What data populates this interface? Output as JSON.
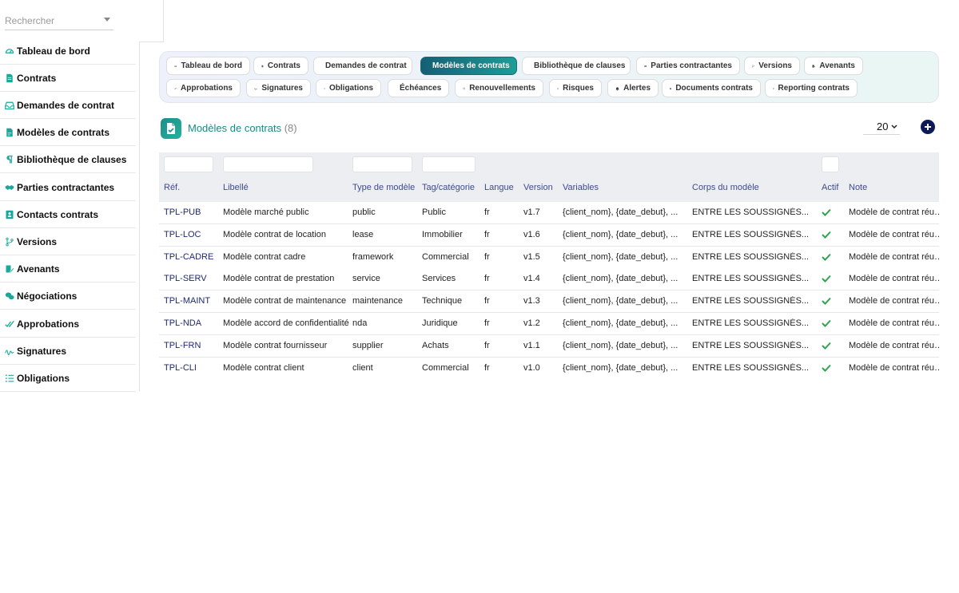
{
  "search": {
    "placeholder": "Rechercher"
  },
  "sidebar": {
    "items": [
      {
        "label": "Tableau de bord",
        "icon": "dashboard-icon"
      },
      {
        "label": "Contrats",
        "icon": "document-icon"
      },
      {
        "label": "Demandes de contrat",
        "icon": "inbox-icon"
      },
      {
        "label": "Modèles de contrats",
        "icon": "file-template-icon"
      },
      {
        "label": "Bibliothèque de clauses",
        "icon": "paragraph-icon"
      },
      {
        "label": "Parties contractantes",
        "icon": "handshake-icon"
      },
      {
        "label": "Contacts contrats",
        "icon": "contact-card-icon"
      },
      {
        "label": "Versions",
        "icon": "branch-icon"
      },
      {
        "label": "Avenants",
        "icon": "edit-document-icon"
      },
      {
        "label": "Négociations",
        "icon": "chat-icon"
      },
      {
        "label": "Approbations",
        "icon": "double-check-icon"
      },
      {
        "label": "Signatures",
        "icon": "signature-icon"
      },
      {
        "label": "Obligations",
        "icon": "list-icon"
      }
    ]
  },
  "tabs": {
    "row1": [
      {
        "label": "Tableau de bord",
        "icon": "dashboard-icon"
      },
      {
        "label": "Contrats",
        "icon": "document-icon"
      },
      {
        "label": "Demandes de contrat",
        "icon": "inbox-icon"
      },
      {
        "label": "Modèles de contrats",
        "icon": "file-template-icon",
        "active": true
      },
      {
        "label": "Bibliothèque de clauses",
        "icon": "paragraph-icon"
      },
      {
        "label": "Parties contractantes",
        "icon": "handshake-icon"
      },
      {
        "label": "Versions",
        "icon": "branch-icon"
      },
      {
        "label": "Avenants",
        "icon": "edit-document-icon"
      }
    ],
    "row2": [
      {
        "label": "Approbations",
        "icon": "double-check-icon"
      },
      {
        "label": "Signatures",
        "icon": "signature-icon"
      },
      {
        "label": "Obligations",
        "icon": "list-icon"
      },
      {
        "label": "Échéances",
        "icon": "calendar-icon"
      },
      {
        "label": "Renouvellements",
        "icon": "refresh-icon"
      },
      {
        "label": "Risques",
        "icon": "warning-icon"
      },
      {
        "label": "Alertes",
        "icon": "bell-icon"
      },
      {
        "label": "Documents contrats",
        "icon": "folder-icon"
      },
      {
        "label": "Reporting contrats",
        "icon": "pie-chart-icon"
      }
    ]
  },
  "header": {
    "title": "Modèles de contrats",
    "count": "(8)",
    "page_size": "20"
  },
  "table": {
    "columns": [
      "Réf.",
      "Libellé",
      "Type de modèle",
      "Tag/catégorie",
      "Langue",
      "Version",
      "Variables",
      "Corps du modèle",
      "Actif",
      "Note"
    ],
    "rows": [
      {
        "ref": "TPL-PUB",
        "libelle": "Modèle marché public",
        "type": "public",
        "tag": "Public",
        "langue": "fr",
        "version": "v1.7",
        "variables": "{client_nom}, {date_debut}, ...",
        "corps": "ENTRE LES SOUSSIGNÉS...",
        "actif": true,
        "note": "Modèle de contrat réutilisable"
      },
      {
        "ref": "TPL-LOC",
        "libelle": "Modèle contrat de location",
        "type": "lease",
        "tag": "Immobilier",
        "langue": "fr",
        "version": "v1.6",
        "variables": "{client_nom}, {date_debut}, ...",
        "corps": "ENTRE LES SOUSSIGNÉS...",
        "actif": true,
        "note": "Modèle de contrat réutilisable"
      },
      {
        "ref": "TPL-CADRE",
        "libelle": "Modèle contrat cadre",
        "type": "framework",
        "tag": "Commercial",
        "langue": "fr",
        "version": "v1.5",
        "variables": "{client_nom}, {date_debut}, ...",
        "corps": "ENTRE LES SOUSSIGNÉS...",
        "actif": true,
        "note": "Modèle de contrat réutilisable"
      },
      {
        "ref": "TPL-SERV",
        "libelle": "Modèle contrat de prestation",
        "type": "service",
        "tag": "Services",
        "langue": "fr",
        "version": "v1.4",
        "variables": "{client_nom}, {date_debut}, ...",
        "corps": "ENTRE LES SOUSSIGNÉS...",
        "actif": true,
        "note": "Modèle de contrat réutilisable"
      },
      {
        "ref": "TPL-MAINT",
        "libelle": "Modèle contrat de maintenance",
        "type": "maintenance",
        "tag": "Technique",
        "langue": "fr",
        "version": "v1.3",
        "variables": "{client_nom}, {date_debut}, ...",
        "corps": "ENTRE LES SOUSSIGNÉS...",
        "actif": true,
        "note": "Modèle de contrat réutilisable"
      },
      {
        "ref": "TPL-NDA",
        "libelle": "Modèle accord de confidentialité",
        "type": "nda",
        "tag": "Juridique",
        "langue": "fr",
        "version": "v1.2",
        "variables": "{client_nom}, {date_debut}, ...",
        "corps": "ENTRE LES SOUSSIGNÉS...",
        "actif": true,
        "note": "Modèle de contrat réutilisable"
      },
      {
        "ref": "TPL-FRN",
        "libelle": "Modèle contrat fournisseur",
        "type": "supplier",
        "tag": "Achats",
        "langue": "fr",
        "version": "v1.1",
        "variables": "{client_nom}, {date_debut}, ...",
        "corps": "ENTRE LES SOUSSIGNÉS...",
        "actif": true,
        "note": "Modèle de contrat réutilisable"
      },
      {
        "ref": "TPL-CLI",
        "libelle": "Modèle contrat client",
        "type": "client",
        "tag": "Commercial",
        "langue": "fr",
        "version": "v1.0",
        "variables": "{client_nom}, {date_debut}, ...",
        "corps": "ENTRE LES SOUSSIGNÉS...",
        "actif": true,
        "note": "Modèle de contrat réutilisable"
      }
    ]
  },
  "colors": {
    "accent": "#1aa89a",
    "active_tab": "#176a78",
    "header_text": "#3f4b8a",
    "check": "#2ea44f",
    "add_button": "#0d1a55"
  }
}
